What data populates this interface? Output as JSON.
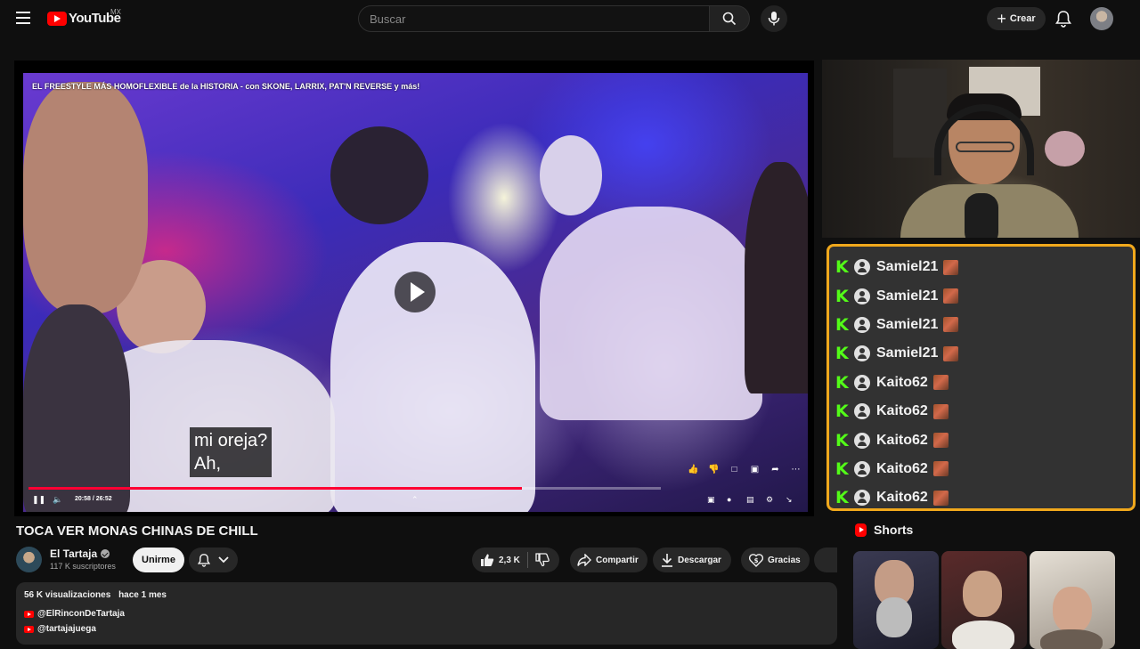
{
  "header": {
    "logo_text": "YouTube",
    "country_code": "MX",
    "search_placeholder": "Buscar",
    "create_label": "Crear"
  },
  "player": {
    "overlay_title": "EL FREESTYLE MÁS HOMOFLEXIBLE de la HISTORIA - con SKONE, LARRIX, PAT'N REVERSE y más!",
    "subtitle_lines": [
      "mi oreja?",
      "Ah,"
    ],
    "time_display": "20:58 / 26:52",
    "progress_fraction": 0.78
  },
  "chat": {
    "messages": [
      {
        "user": "Samiel21"
      },
      {
        "user": "Samiel21"
      },
      {
        "user": "Samiel21"
      },
      {
        "user": "Samiel21"
      },
      {
        "user": "Kaito62"
      },
      {
        "user": "Kaito62"
      },
      {
        "user": "Kaito62"
      },
      {
        "user": "Kaito62"
      },
      {
        "user": "Kaito62"
      }
    ],
    "border_color": "#f0a81c",
    "badge_color": "#53fc18"
  },
  "video": {
    "title": "TOCA VER MONAS CHINAS DE CHILL",
    "channel_name": "El Tartaja",
    "subscribers": "117 K suscriptores",
    "join_label": "Unirme",
    "like_count": "2,3 K",
    "share_label": "Compartir",
    "download_label": "Descargar",
    "thanks_label": "Gracias"
  },
  "description": {
    "views": "56 K visualizaciones",
    "age": "hace 1 mes",
    "links": [
      "@ElRinconDeTartaja",
      "@tartajajuega"
    ]
  },
  "shorts": {
    "heading": "Shorts"
  },
  "colors": {
    "accent_red": "#ff0000",
    "progress_red": "#ff0033",
    "background": "#0f0f0f"
  }
}
